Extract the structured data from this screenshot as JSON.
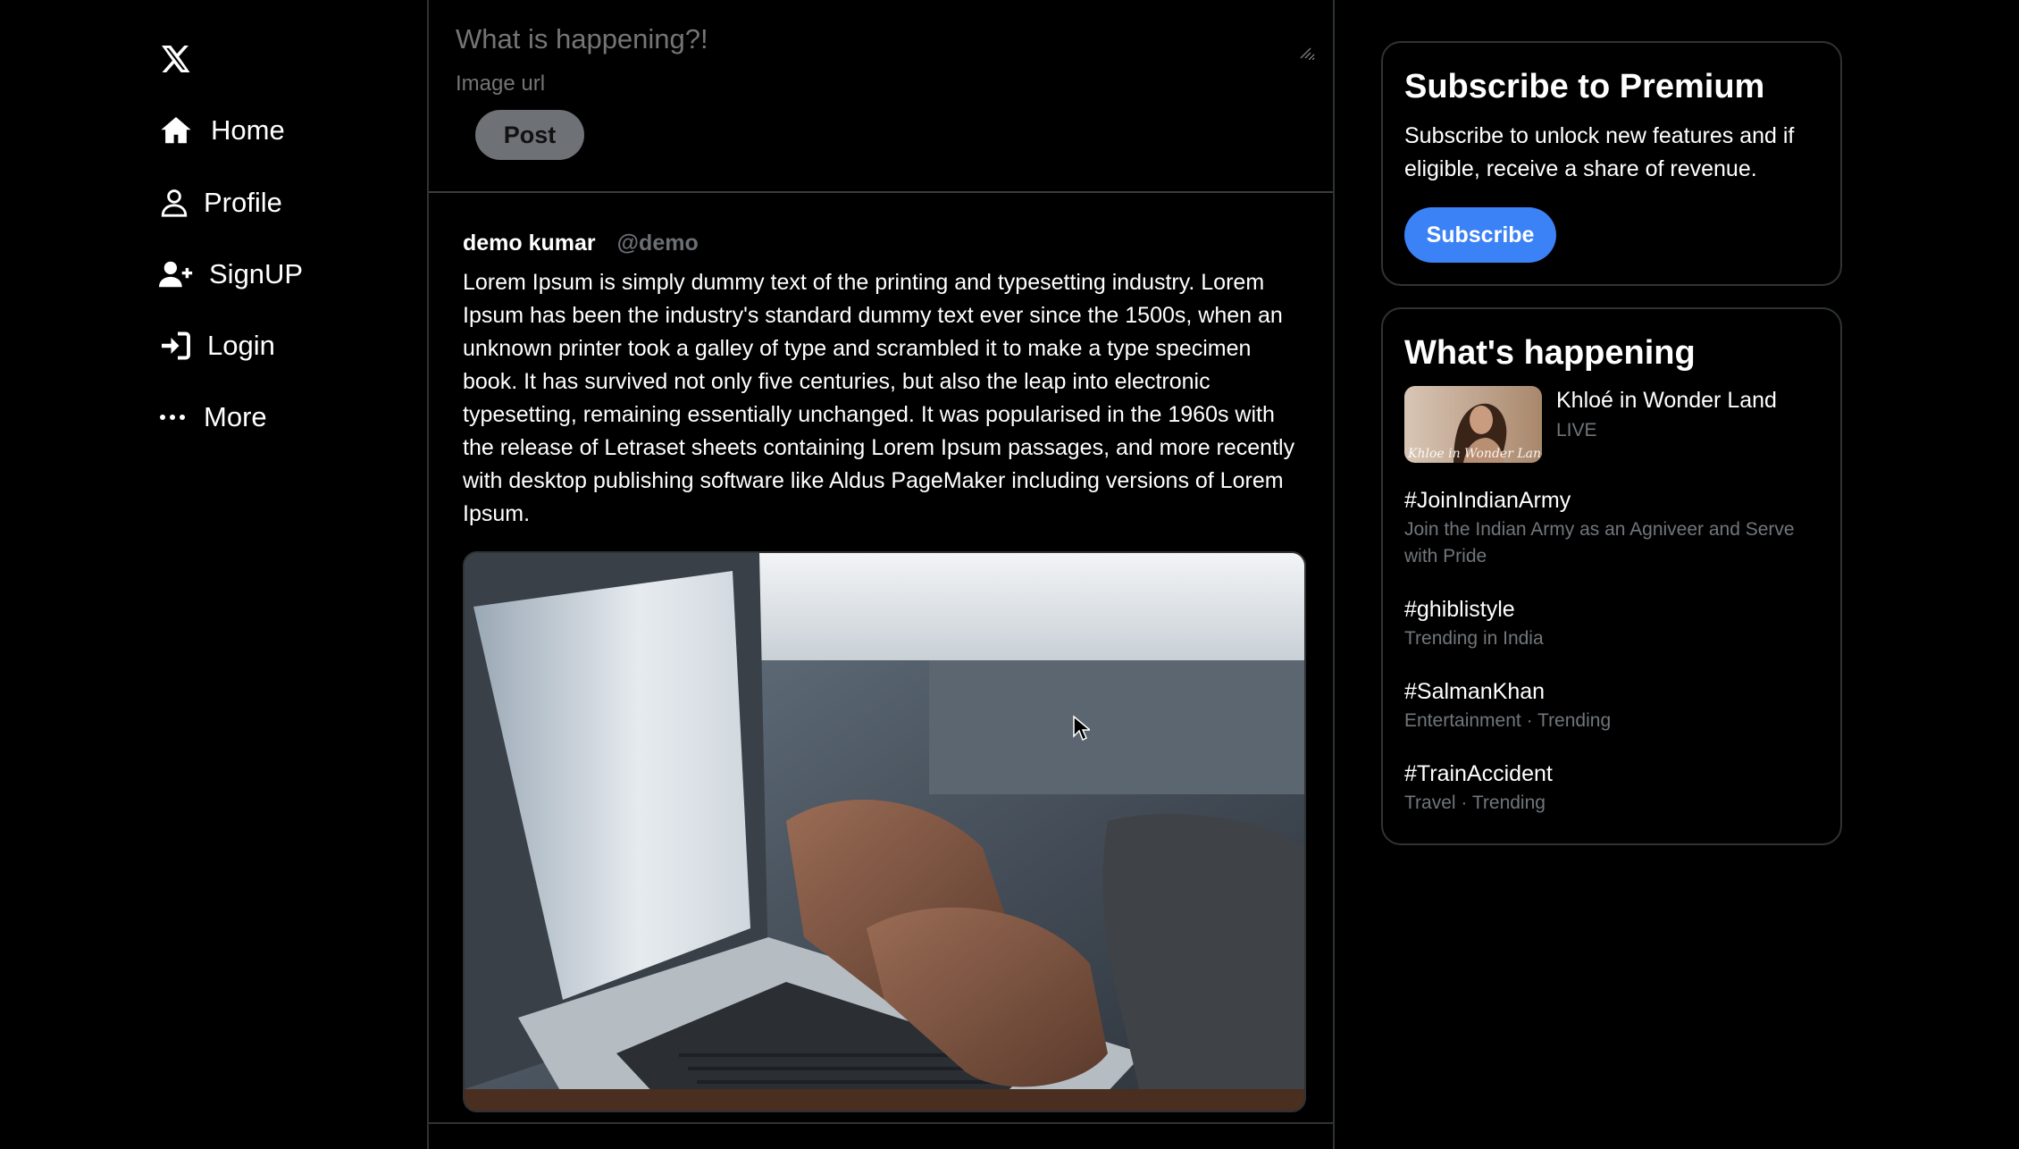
{
  "nav": {
    "logo_label": "X",
    "items": [
      {
        "label": "Home",
        "icon": "home-icon"
      },
      {
        "label": "Profile",
        "icon": "user-icon"
      },
      {
        "label": "SignUP",
        "icon": "user-plus-icon"
      },
      {
        "label": "Login",
        "icon": "login-icon"
      },
      {
        "label": "More",
        "icon": "more-icon"
      }
    ]
  },
  "composer": {
    "text_placeholder": "What is happening?!",
    "image_placeholder": "Image url",
    "post_label": "Post"
  },
  "tweet": {
    "name": "demo kumar",
    "handle": "@demo",
    "body": "Lorem Ipsum is simply dummy text of the printing and typesetting industry. Lorem Ipsum has been the industry's standard dummy text ever since the 1500s, when an unknown printer took a galley of type and scrambled it to make a type specimen book. It has survived not only five centuries, but also the leap into electronic typesetting, remaining essentially unchanged. It was popularised in the 1960s with the release of Letraset sheets containing Lorem Ipsum passages, and more recently with desktop publishing software like Aldus PageMaker including versions of Lorem Ipsum."
  },
  "premium": {
    "title": "Subscribe to Premium",
    "text": "Subscribe to unlock new features and if eligible, receive a share of revenue.",
    "button_label": "Subscribe"
  },
  "happening": {
    "title": "What's happening",
    "live": {
      "title": "Khloé in Wonder Land",
      "status": "LIVE",
      "thumb_caption": "Khloe in Wonder Land"
    },
    "trends": [
      {
        "tag": "#JoinIndianArmy",
        "meta": "Join the Indian Army as an Agniveer and Serve with Pride"
      },
      {
        "tag": "#ghiblistyle",
        "meta": "Trending in India"
      },
      {
        "tag": "#SalmanKhan",
        "meta": "Entertainment · Trending"
      },
      {
        "tag": "#TrainAccident",
        "meta": "Travel · Trending"
      }
    ]
  },
  "colors": {
    "background": "#000000",
    "accent_blue": "#3b82f6",
    "muted_text": "#71767b",
    "border": "#2f3336"
  }
}
